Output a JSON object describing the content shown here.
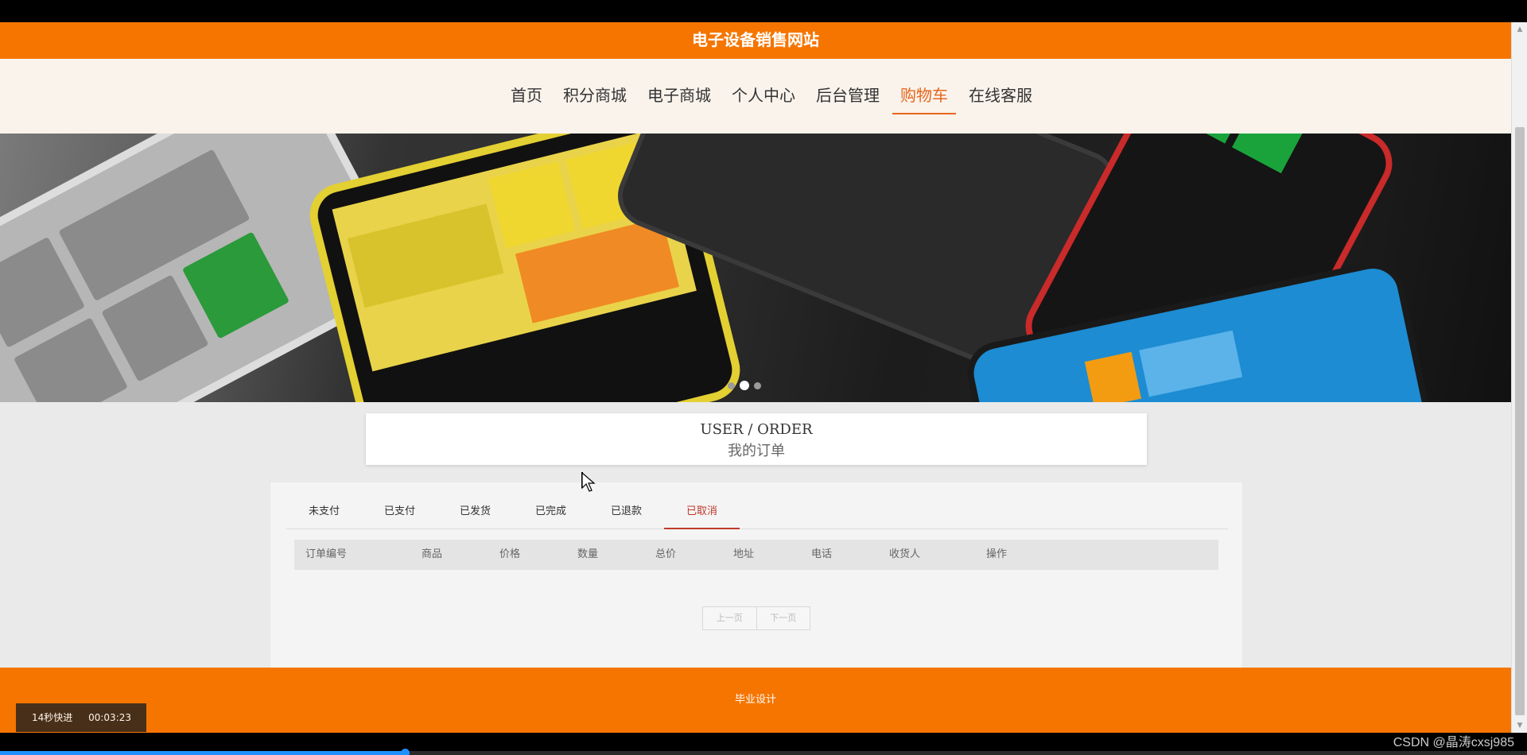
{
  "site": {
    "title": "电子设备销售网站"
  },
  "nav": {
    "items": [
      {
        "label": "首页",
        "active": false
      },
      {
        "label": "积分商城",
        "active": false
      },
      {
        "label": "电子商城",
        "active": false
      },
      {
        "label": "个人中心",
        "active": false
      },
      {
        "label": "后台管理",
        "active": false
      },
      {
        "label": "购物车",
        "active": true
      },
      {
        "label": "在线客服",
        "active": false
      }
    ]
  },
  "banner": {
    "slides_total": 3,
    "active_slide": 2
  },
  "section": {
    "title_en": "USER / ORDER",
    "title_cn": "我的订单"
  },
  "order_tabs": [
    {
      "label": "未支付",
      "active": false
    },
    {
      "label": "已支付",
      "active": false
    },
    {
      "label": "已发货",
      "active": false
    },
    {
      "label": "已完成",
      "active": false
    },
    {
      "label": "已退款",
      "active": false
    },
    {
      "label": "已取消",
      "active": true
    }
  ],
  "table": {
    "columns": [
      "订单编号",
      "商品",
      "价格",
      "数量",
      "总价",
      "地址",
      "电话",
      "收货人",
      "操作"
    ],
    "rows": []
  },
  "pager": {
    "prev": "上一页",
    "next": "下一页"
  },
  "footer": {
    "text": "毕业设计"
  },
  "player": {
    "speed_label": "14秒快进",
    "time": "00:03:23",
    "progress_fraction": 0.265
  },
  "watermark": "CSDN @晶涛cxsj985",
  "colors": {
    "brand_orange": "#f57500",
    "nav_active": "#e8651a",
    "tab_active": "#c0392b"
  }
}
